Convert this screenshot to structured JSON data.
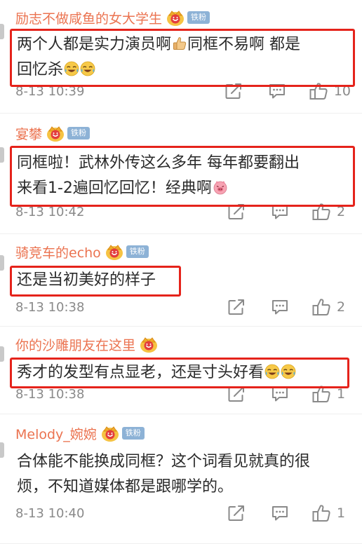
{
  "colors": {
    "username": "#eb7350",
    "badge": "#8db2d6",
    "highlight": "#e5231b",
    "meta": "#8a8a8a"
  },
  "comments": [
    {
      "username": "励志不做咸鱼的女大学生",
      "badge": "铁粉",
      "lines": [
        "两个人都是实力演员啊",
        "回忆杀"
      ],
      "line1_tail": "同框不易啊 都是",
      "time": "8-13 10:39",
      "likes": "10",
      "icons": [
        "crown-icon",
        "thumbs-up-emoji",
        "laugh-cry-emoji"
      ]
    },
    {
      "username": "宴攀",
      "badge": "铁粉",
      "lines": [
        "同框啦！武林外传这么多年 每年都要翻出",
        "来看1-2遍回忆回忆！经典啊"
      ],
      "time": "8-13 10:42",
      "likes": "2",
      "icons": [
        "crown-icon",
        "pig-emoji"
      ]
    },
    {
      "username": "骑竞车的echo",
      "badge": "铁粉",
      "lines": [
        "还是当初美好的样子"
      ],
      "time": "8-13 10:38",
      "likes": "2",
      "icons": [
        "crown-icon"
      ]
    },
    {
      "username": "你的沙雕朋友在这里",
      "badge": "",
      "lines": [
        "秀才的发型有点显老，还是寸头好看"
      ],
      "time": "8-13 10:38",
      "likes": "1",
      "icons": [
        "crown-icon",
        "laugh-cry-emoji"
      ]
    },
    {
      "username": "Melody_婉婉",
      "badge": "铁粉",
      "lines": [
        "合体能不能换成同框？这个词看见就真的很",
        "烦，不知道媒体都是跟哪学的。"
      ],
      "time": "8-13 10:40",
      "likes": "1",
      "icons": [
        "crown-icon"
      ]
    }
  ]
}
